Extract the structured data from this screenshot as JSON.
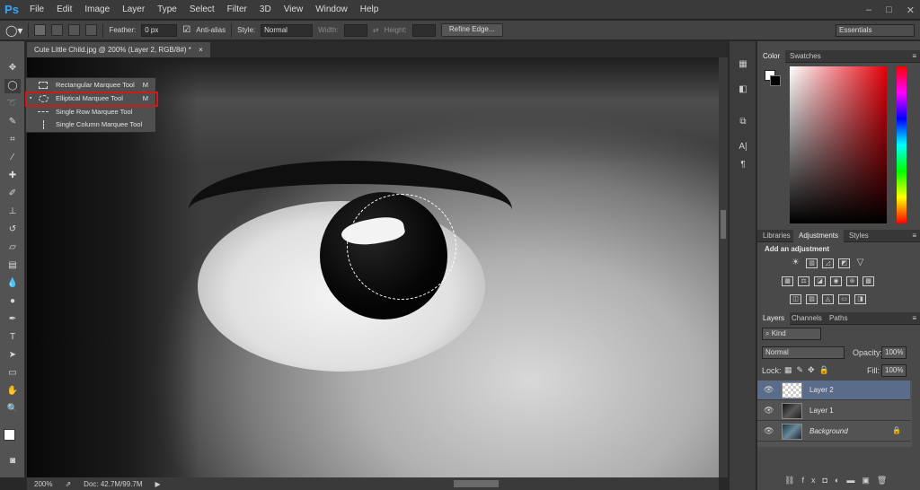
{
  "app": {
    "logo": "Ps"
  },
  "menu": [
    "File",
    "Edit",
    "Image",
    "Layer",
    "Type",
    "Select",
    "Filter",
    "3D",
    "View",
    "Window",
    "Help"
  ],
  "window_controls": {
    "minimize": "–",
    "restore": "□",
    "close": "✕"
  },
  "options_bar": {
    "feather_label": "Feather:",
    "feather_value": "0 px",
    "antialias_label": "Anti-alias",
    "style_label": "Style:",
    "style_value": "Normal",
    "width_label": "Width:",
    "height_label": "Height:",
    "refine_button": "Refine Edge...",
    "workspace": "Essentials"
  },
  "document": {
    "tab_title": "Cute Little Child.jpg @ 200% (Layer 2, RGB/8#) *",
    "close": "×"
  },
  "status": {
    "zoom": "200%",
    "doc": "Doc: 42.7M/99.7M"
  },
  "flyout": {
    "items": [
      {
        "label": "Rectangular Marquee Tool",
        "key": "M"
      },
      {
        "label": "Elliptical Marquee Tool",
        "key": "M"
      },
      {
        "label": "Single Row Marquee Tool",
        "key": ""
      },
      {
        "label": "Single Column Marquee Tool",
        "key": ""
      }
    ]
  },
  "color_panel": {
    "tabs": [
      "Color",
      "Swatches"
    ]
  },
  "adjust_panel": {
    "tabs": [
      "Libraries",
      "Adjustments",
      "Styles"
    ],
    "heading": "Add an adjustment"
  },
  "layers_panel": {
    "tabs": [
      "Layers",
      "Channels",
      "Paths"
    ],
    "filter": "Kind",
    "blend_mode": "Normal",
    "opacity_label": "Opacity:",
    "opacity_value": "100%",
    "lock_label": "Lock:",
    "fill_label": "Fill:",
    "fill_value": "100%",
    "layers": [
      {
        "name": "Layer 2",
        "selected": true
      },
      {
        "name": "Layer 1",
        "selected": false
      },
      {
        "name": "Background",
        "selected": false,
        "locked": true
      }
    ]
  },
  "colors": {
    "selection_highlight": "#d01a1a",
    "selected_layer": "#5b6c8a",
    "ps_blue": "#31a8ff"
  }
}
